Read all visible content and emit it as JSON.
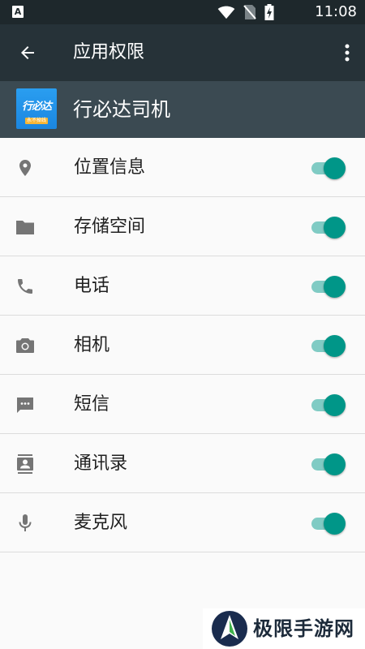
{
  "status_bar": {
    "time": "11:08",
    "app_badge": "A"
  },
  "toolbar": {
    "title": "应用权限"
  },
  "app": {
    "name": "行必达司机",
    "logo_text": "行必达",
    "logo_tag": "永不掉线"
  },
  "permissions": [
    {
      "label": "位置信息",
      "icon": "location-icon",
      "enabled": true
    },
    {
      "label": "存储空间",
      "icon": "folder-icon",
      "enabled": true
    },
    {
      "label": "电话",
      "icon": "phone-icon",
      "enabled": true
    },
    {
      "label": "相机",
      "icon": "camera-icon",
      "enabled": true
    },
    {
      "label": "短信",
      "icon": "sms-icon",
      "enabled": true
    },
    {
      "label": "通讯录",
      "icon": "contacts-icon",
      "enabled": true
    },
    {
      "label": "麦克风",
      "icon": "microphone-icon",
      "enabled": true
    }
  ],
  "watermark": {
    "text": "极限手游网"
  },
  "colors": {
    "status_bar": "#1e282c",
    "toolbar": "#263238",
    "app_header": "#3b4a52",
    "toggle_thumb": "#009688",
    "toggle_track": "#80cbc4",
    "icon": "#757575"
  }
}
